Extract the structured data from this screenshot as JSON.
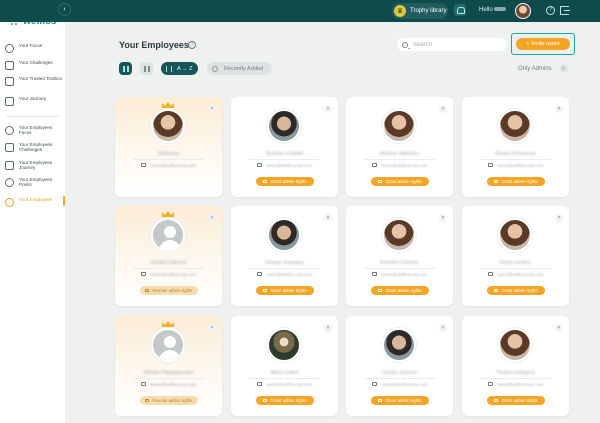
{
  "brand": {
    "logo_text": "wellics"
  },
  "topbar": {
    "trophy_label": "Trophy library",
    "hello_text": "Hello",
    "help_icon": "help-icon",
    "logout_icon": "logout-icon"
  },
  "sidebar": {
    "items": [
      {
        "label": "Your Focus",
        "icon": "target-icon",
        "active": false
      },
      {
        "label": "Your Challenges",
        "icon": "challenge-icon",
        "active": false
      },
      {
        "label": "Your Trusted Toolbox",
        "icon": "book-icon",
        "active": false
      },
      {
        "label": "Your Journey",
        "icon": "chart-icon",
        "active": false
      },
      {
        "label": "Your Employees Focus",
        "icon": "target-icon",
        "active": false
      },
      {
        "label": "Your Employees Challenges",
        "icon": "challenge-icon",
        "active": false
      },
      {
        "label": "Your Employees Journey",
        "icon": "chart-icon",
        "active": false
      },
      {
        "label": "Your Employees Points",
        "icon": "award-icon",
        "active": false
      },
      {
        "label": "Your Employees",
        "icon": "users-icon",
        "active": true
      }
    ]
  },
  "header": {
    "title": "Your Employees",
    "search_placeholder": "Search",
    "invite_label": "+ Invite users"
  },
  "toolbar": {
    "sort_label": "A → Z",
    "recent_label": "Recently Added",
    "only_admins_label": "Only Admins"
  },
  "colors": {
    "topbar": "#0f4a4c",
    "accent": "#f3a526",
    "teal": "#1aa7a4"
  },
  "employees": [
    {
      "name": "Marianna",
      "email": "name@wellicscorp.com",
      "admin": true,
      "avatar": "photo-woman",
      "rights_label": ""
    },
    {
      "name": "Andreas Kontidis",
      "email": "name@wellicscorp.com",
      "admin": false,
      "avatar": "photo-man",
      "rights_label": "Grant admin rights"
    },
    {
      "name": "Antonia Valtetsiou",
      "email": "name@wellicscorp.com",
      "admin": false,
      "avatar": "photo-woman",
      "rights_label": "Grant admin rights"
    },
    {
      "name": "Eleana Kleomenis",
      "email": "name@wellicscorp.com",
      "admin": false,
      "avatar": "photo-woman",
      "rights_label": "Grant admin rights"
    },
    {
      "name": "Dimitris Ioannou",
      "email": "name@wellicscorp.com",
      "admin": true,
      "avatar": "placeholder",
      "rights_label": "Revoke admin rights"
    },
    {
      "name": "George Georgiou",
      "email": "name@wellicscorp.com",
      "admin": false,
      "avatar": "photo-man",
      "rights_label": "Grant admin rights"
    },
    {
      "name": "Katerina Christou",
      "email": "name@wellicscorp.com",
      "admin": false,
      "avatar": "photo-woman",
      "rights_label": "Grant admin rights"
    },
    {
      "name": "Maria Lavidou",
      "email": "name@wellicscorp.com",
      "admin": false,
      "avatar": "photo-woman",
      "rights_label": "Grant admin rights"
    },
    {
      "name": "Nikolas Papadopoulos",
      "email": "name@wellicscorp.com",
      "admin": true,
      "avatar": "placeholder",
      "rights_label": "Revoke admin rights"
    },
    {
      "name": "Nikos Ioakim",
      "email": "name@wellicscorp.com",
      "admin": false,
      "avatar": "photo-landscape",
      "rights_label": "Grant admin rights"
    },
    {
      "name": "Orestis Ioannou",
      "email": "name@wellicscorp.com",
      "admin": false,
      "avatar": "photo-man",
      "rights_label": "Grant admin rights"
    },
    {
      "name": "Pavlina Kalogera",
      "email": "name@wellicscorp.com",
      "admin": false,
      "avatar": "photo-woman",
      "rights_label": "Grant admin rights"
    }
  ]
}
